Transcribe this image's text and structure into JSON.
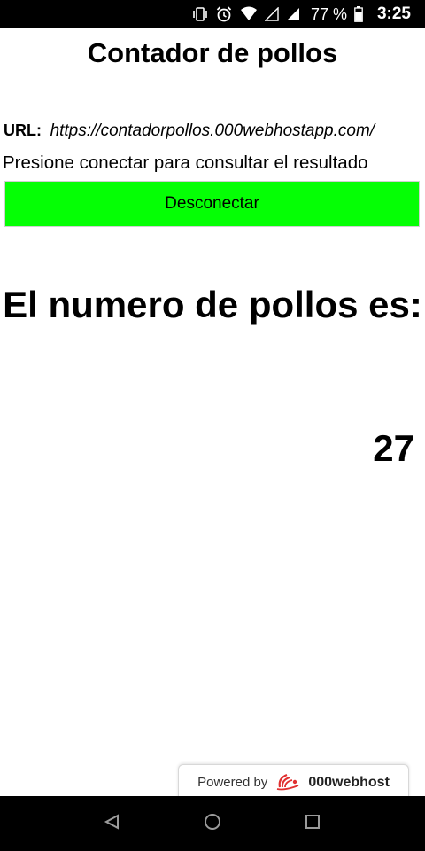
{
  "status_bar": {
    "icons": [
      "vibrate-icon",
      "alarm-icon",
      "wifi-icon",
      "signal-empty-icon",
      "signal-icon",
      "battery-icon"
    ],
    "battery": "77 %",
    "time": "3:25"
  },
  "page": {
    "title": "Contador de pollos",
    "url_label": "URL:",
    "url_value": "https://contadorpollos.000webhostapp.com/",
    "instruction": "Presione conectar para consultar el resultado",
    "connect_button_label": "Desconectar",
    "connect_button_color": "#05ff05",
    "result_heading": "El numero de pollos es:",
    "result_value": "27"
  },
  "footer_badge": {
    "prefix": "Powered by",
    "brand": "000webhost"
  },
  "nav_bar": {
    "buttons": [
      "back-icon",
      "home-icon",
      "recents-icon"
    ]
  }
}
